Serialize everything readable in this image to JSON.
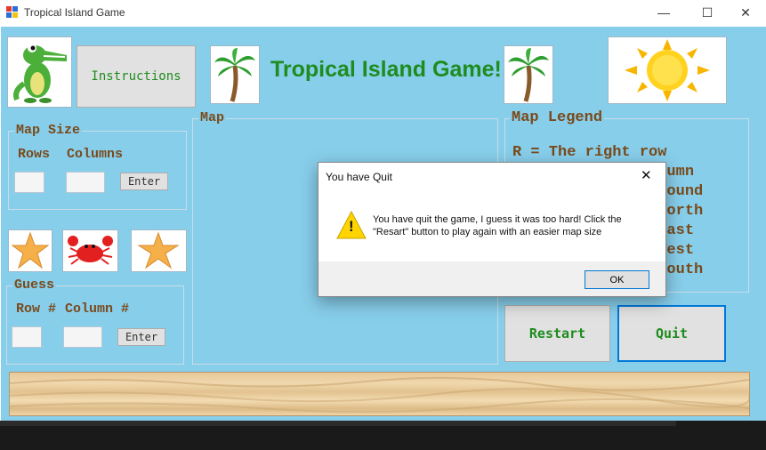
{
  "window": {
    "title": "Tropical Island Game",
    "min_glyph": "—",
    "max_glyph": "☐",
    "close_glyph": "✕"
  },
  "header": {
    "instructions_label": "Instructions",
    "game_title": "Tropical Island Game!"
  },
  "map_size": {
    "group_label": "Map Size",
    "rows_label": "Rows",
    "columns_label": "Columns",
    "enter_label": "Enter"
  },
  "guess": {
    "group_label": "Guess",
    "row_label": "Row #",
    "column_label": "Column #",
    "enter_label": "Enter"
  },
  "map": {
    "group_label": "Map"
  },
  "legend": {
    "group_label": "Map Legend",
    "lines": [
      "R = The right row",
      "C = The right column",
      "T = Treasure is found",
      "N = Treasure is North",
      "E = Treasure is East",
      "W = Treasure is West",
      "S = Treasure is South"
    ]
  },
  "controls": {
    "restart_label": "Restart",
    "quit_label": "Quit"
  },
  "dialog": {
    "title": "You have Quit",
    "close_glyph": "✕",
    "warning_glyph": "!",
    "message_line1": "You have quit the game, I guess it was too hard! Click the",
    "message_line2": "\"Resart\" button to play again with an easier map size",
    "ok_label": "OK"
  },
  "colors": {
    "background": "#87ceeb",
    "title_green": "#1e8c1e",
    "label_brown": "#7a4a1a"
  }
}
